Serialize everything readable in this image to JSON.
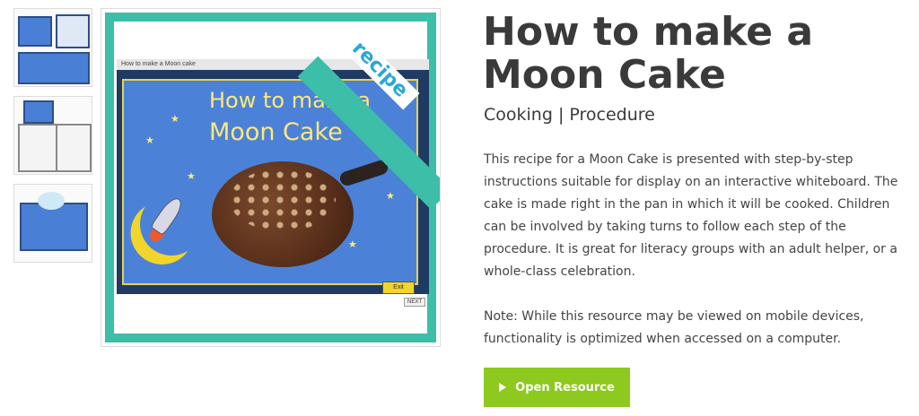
{
  "thumbnails": [
    {
      "label": "thumbnail-1"
    },
    {
      "label": "thumbnail-2"
    },
    {
      "label": "thumbnail-3"
    }
  ],
  "preview": {
    "slide_header": "How to make a Moon cake",
    "slide_title_line1": "How to make a",
    "slide_title_line2": "Moon Cake",
    "ribbon_text": "recipe",
    "exit_label": "Exit",
    "next_label": "NEXT",
    "colors": {
      "frame": "#3cbea8",
      "slide_bg": "#4b82d8",
      "title": "#ffe878"
    }
  },
  "resource": {
    "title": "How to make a Moon Cake",
    "subtitle": "Cooking | Procedure",
    "description": "This recipe for a Moon Cake is presented with step-by-step instructions suitable for display on an interactive whiteboard. The cake is made right in the pan in which it will be cooked. Children can be involved by taking turns to follow each step of the procedure. It is great for literacy groups with an adult helper, or a whole-class celebration.",
    "note": "Note: While this resource may be viewed on mobile devices, functionality is optimized when accessed on a computer.",
    "open_button_label": "Open Resource",
    "button_color": "#8dc91e"
  }
}
